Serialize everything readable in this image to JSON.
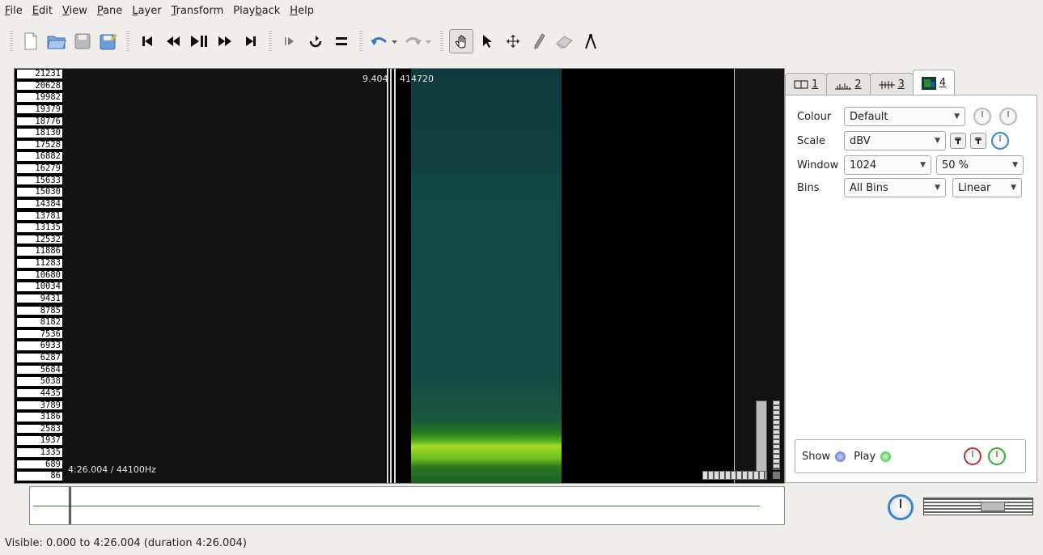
{
  "menubar": {
    "items": [
      {
        "ul": "F",
        "rest": "ile"
      },
      {
        "ul": "E",
        "rest": "dit"
      },
      {
        "ul": "V",
        "rest": "iew"
      },
      {
        "ul": "P",
        "rest": "ane"
      },
      {
        "ul": "L",
        "rest": "ayer"
      },
      {
        "ul": "T",
        "rest": "ransform"
      },
      {
        "pre": "Play",
        "ul": "b",
        "rest": "ack"
      },
      {
        "ul": "H",
        "rest": "elp"
      }
    ]
  },
  "toolbar": {
    "icons": [
      "new-document-icon",
      "open-folder-icon",
      "save-icon",
      "save-as-icon",
      "rewind-start-icon",
      "rewind-icon",
      "play-pause-icon",
      "fast-forward-icon",
      "forward-end-icon",
      "play-selection-icon",
      "loop-icon",
      "solo-icon",
      "undo-icon",
      "redo-icon",
      "navigate-hand-icon",
      "select-arrow-icon",
      "move-icon",
      "draw-pencil-icon",
      "erase-icon",
      "measure-icon"
    ]
  },
  "pane": {
    "scale_labels": [
      "21231",
      "20628",
      "19982",
      "19379",
      "18776",
      "18130",
      "17528",
      "16882",
      "16279",
      "15633",
      "15030",
      "14384",
      "13781",
      "13135",
      "12532",
      "11886",
      "11283",
      "10680",
      "10034",
      "9431",
      "8785",
      "8182",
      "7536",
      "6933",
      "6287",
      "5684",
      "5038",
      "4435",
      "3789",
      "3186",
      "2583",
      "1937",
      "1335",
      "689",
      "86"
    ],
    "cursor_time": "9.404",
    "cursor_frame": "414720",
    "duration_rate": "4:26.004 / 44100Hz"
  },
  "tabs": [
    {
      "num": "1",
      "icon": "pane-icon"
    },
    {
      "num": "2",
      "icon": "waveform-icon"
    },
    {
      "num": "3",
      "icon": "time-ruler-icon"
    },
    {
      "num": "4",
      "icon": "spectrogram-icon"
    }
  ],
  "properties": {
    "colour_label": "Colour",
    "colour_value": "Default",
    "scale_label": "Scale",
    "scale_value": "dBV",
    "window_label": "Window",
    "window_value": "1024",
    "overlap_value": "50 %",
    "bins_label": "Bins",
    "bins_value": "All Bins",
    "bins_scale_value": "Linear",
    "show_label": "Show",
    "play_label": "Play"
  },
  "status": {
    "text": "Visible: 0.000 to 4:26.004 (duration 4:26.004)"
  },
  "colors": {
    "show_dot": "#4f63c6",
    "play_dot": "#2bb52b",
    "accent_knob": "#3b86c8"
  }
}
